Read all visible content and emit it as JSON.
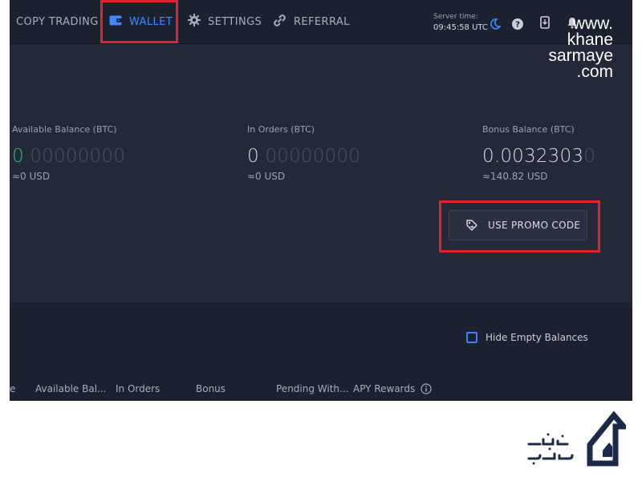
{
  "nav": {
    "copy_trading": "COPY TRADING",
    "wallet": "WALLET",
    "settings": "SETTINGS",
    "referral": "REFERRAL",
    "server_time_label": "Server time:",
    "server_time_value": "09:45:58 UTC",
    "icons": [
      "wallet-icon",
      "gear-icon",
      "link-icon",
      "moon-icon",
      "help-icon",
      "download-icon",
      "bell-icon"
    ]
  },
  "balances": {
    "available": {
      "label": "Available Balance (BTC)",
      "value_strong": "0",
      "value_faint": ".00000000",
      "usd": "≈0 USD"
    },
    "in_orders": {
      "label": "In Orders (BTC)",
      "value_strong": "0",
      "value_faint": ".00000000",
      "usd": "≈0 USD"
    },
    "bonus": {
      "label": "Bonus Balance (BTC)",
      "value_strong": "0.0032303",
      "value_faint": "0",
      "usd": "≈140.82 USD"
    }
  },
  "promo": {
    "label": "USE PROMO CODE"
  },
  "table": {
    "hide_empty_label": "Hide Empty Balances",
    "columns": [
      "e",
      "Available Bal...",
      "In Orders",
      "Bonus",
      "Pending With...",
      "APY Rewards"
    ]
  },
  "watermark": {
    "line1": "www.",
    "line2": "khane",
    "line3": "sarmaye",
    "line4": ".com",
    "logo_text": "خانه سرمایه"
  },
  "colors": {
    "accent_blue": "#3d8bff",
    "green": "#2fbf71",
    "highlight_red": "#e0232e"
  }
}
